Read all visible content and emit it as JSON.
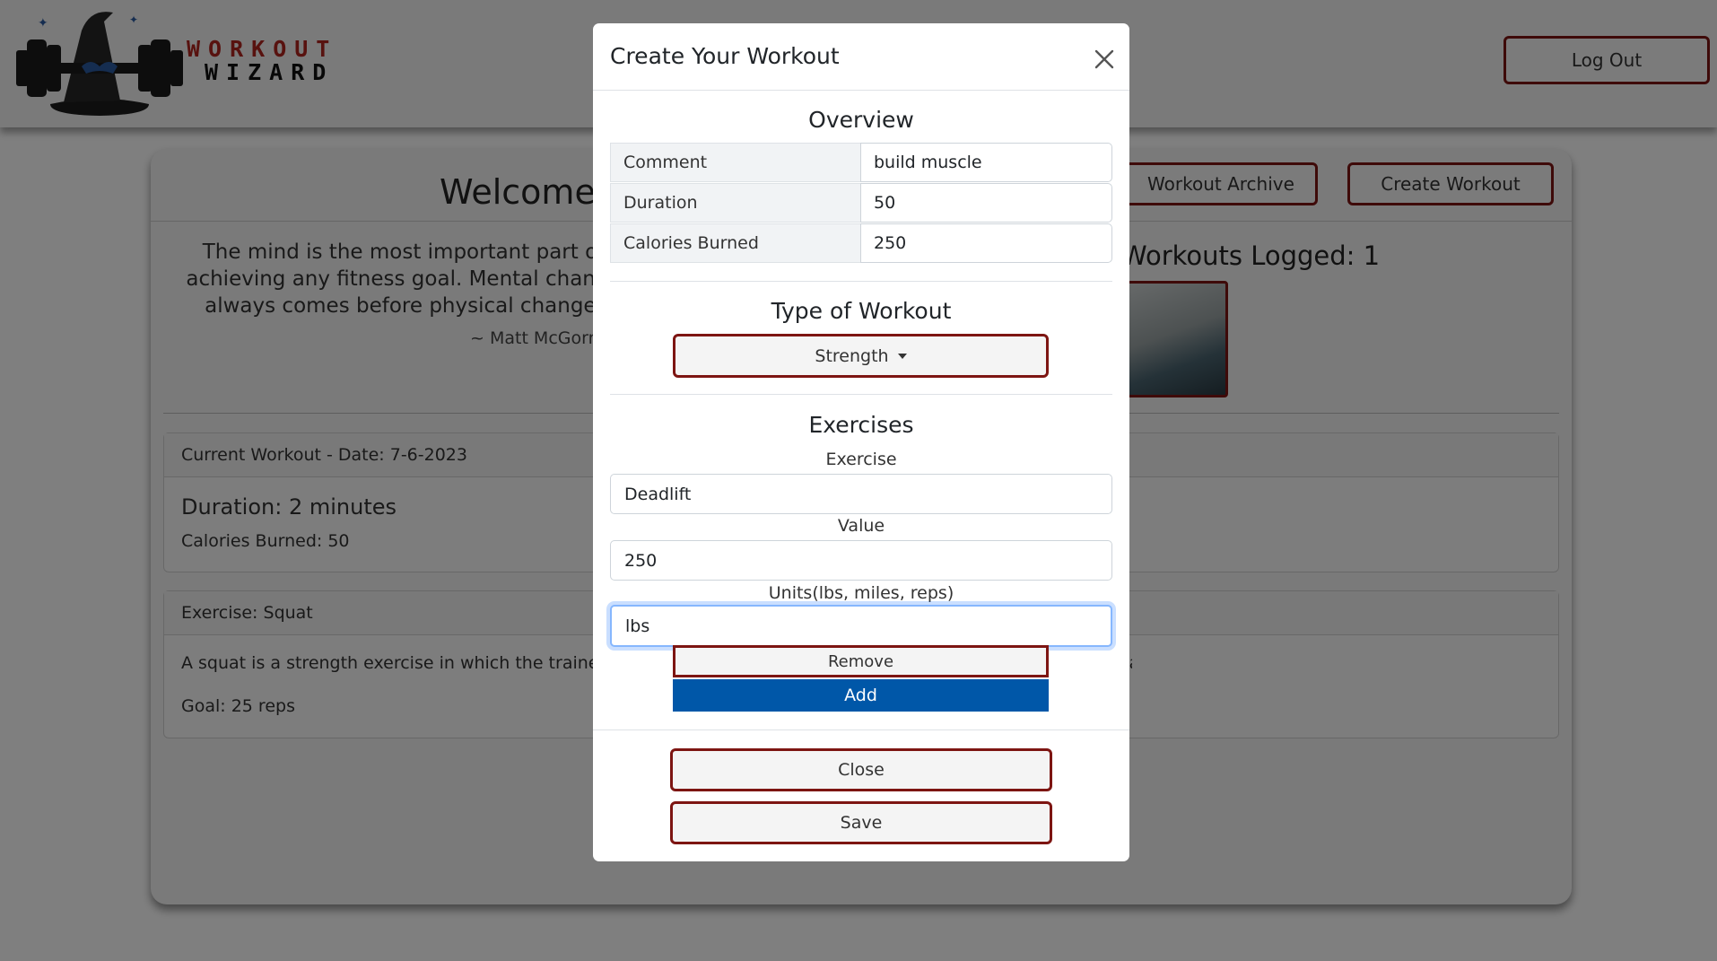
{
  "navbar": {
    "logo_line1": "WORKOUT",
    "logo_line2": "WIZARD",
    "logout_label": "Log Out"
  },
  "main": {
    "welcome": "Welcome",
    "archive_label": "Workout Archive",
    "create_label": "Create Workout",
    "quote": "The mind is the most important part of achieving any fitness goal. Mental change always comes before physical change.",
    "quote_author": "~ Matt McGorry",
    "logged": "Workouts Logged: 1"
  },
  "current_workout": {
    "header": "Current Workout - Date: 7-6-2023",
    "duration": "Duration: 2 minutes",
    "calories": "Calories Burned: 50"
  },
  "exercise_card": {
    "header": "Exercise: Squat",
    "description": "A squat is a strength exercise in which the trainee lowers their hips from a standing position and then stands back up.",
    "goal": "Goal: 25 reps"
  },
  "modal": {
    "title": "Create Your Workout",
    "overview_title": "Overview",
    "overview": [
      {
        "label": "Comment",
        "value": "build muscle"
      },
      {
        "label": "Duration",
        "value": "50"
      },
      {
        "label": "Calories Burned",
        "value": "250"
      }
    ],
    "type_title": "Type of Workout",
    "type_selected": "Strength",
    "exercises_title": "Exercises",
    "exercise_label": "Exercise",
    "exercise_value": "Deadlift",
    "value_label": "Value",
    "value_value": "250",
    "units_label": "Units(lbs, miles, reps)",
    "units_value": "lbs",
    "remove_label": "Remove",
    "add_label": "Add",
    "close_label": "Close",
    "save_label": "Save"
  },
  "colors": {
    "accent_border": "#7d1512",
    "add_button": "#0057a8",
    "overlay": "rgba(0,0,0,0.5)"
  }
}
